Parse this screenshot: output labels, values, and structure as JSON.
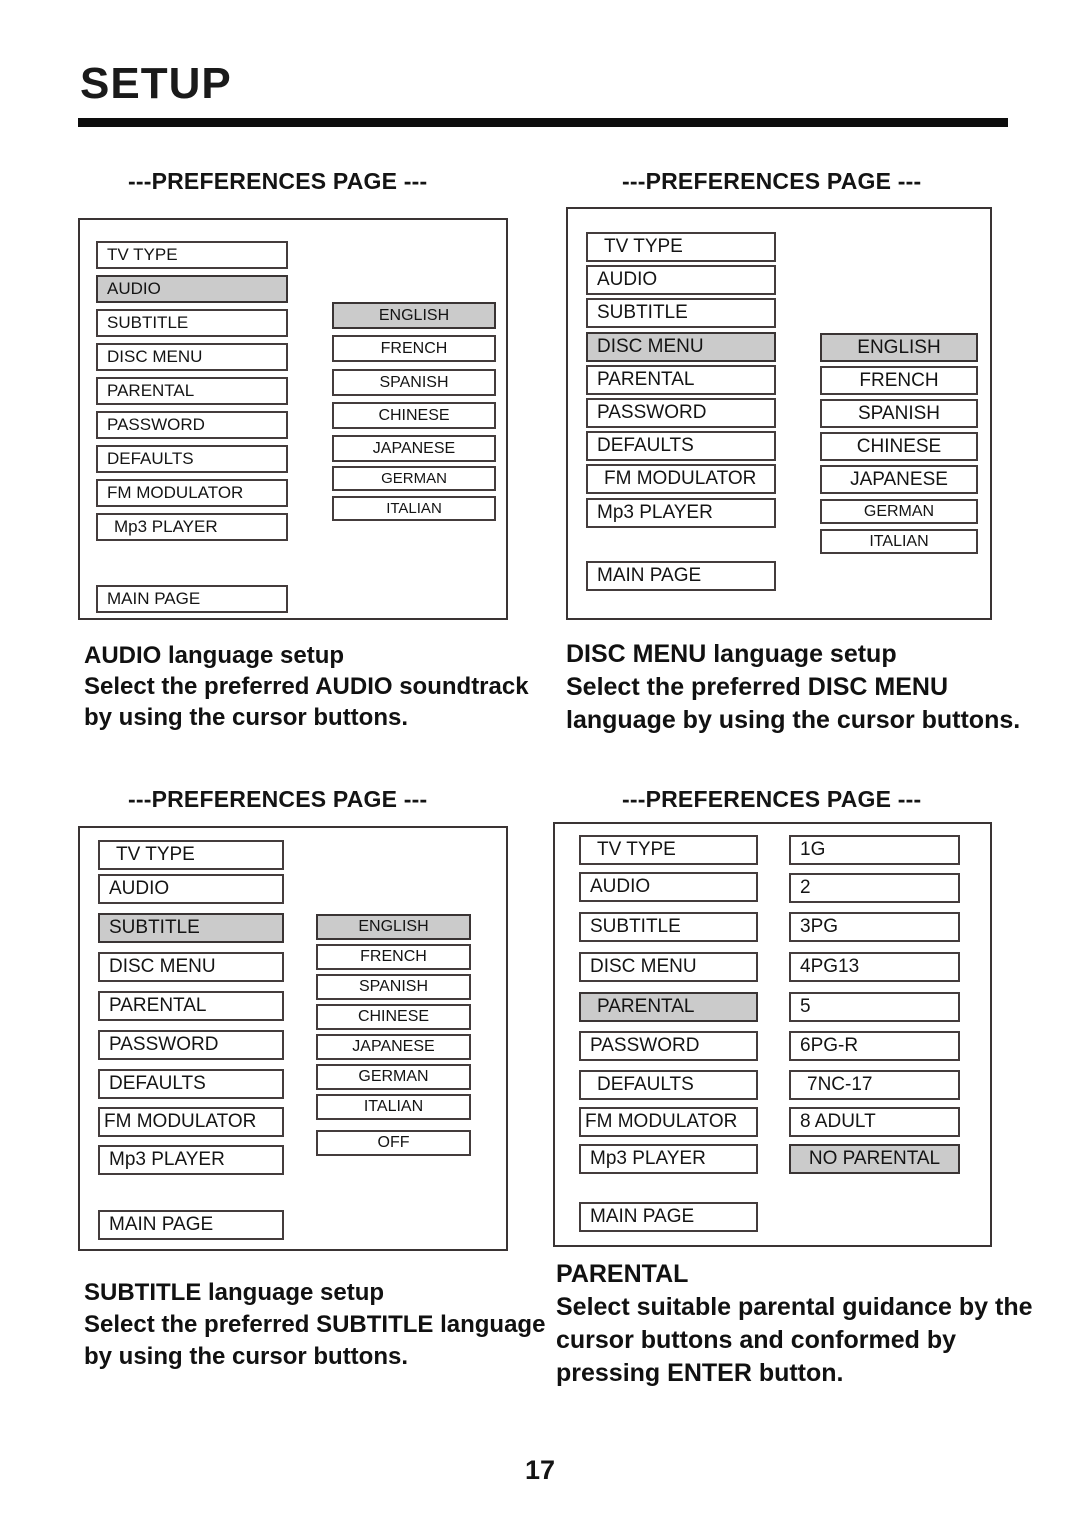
{
  "document": {
    "title": "SETUP",
    "page_number": "17"
  },
  "panels": [
    {
      "heading": "---PREFERENCES PAGE ---",
      "menu": [
        "TV  TYPE",
        "AUDIO",
        "SUBTITLE",
        "DISC MENU",
        "PARENTAL",
        "PASSWORD",
        "DEFAULTS",
        "FM MODULATOR",
        "Mp3 PLAYER"
      ],
      "menu_selected": "AUDIO",
      "footer_item": "MAIN PAGE",
      "options": [
        "ENGLISH",
        "FRENCH",
        "SPANISH",
        "CHINESE",
        "JAPANESE",
        "GERMAN",
        "ITALIAN"
      ],
      "option_selected": "ENGLISH",
      "caption": [
        "AUDIO language setup",
        "Select the preferred AUDIO soundtrack",
        "by using the cursor buttons."
      ]
    },
    {
      "heading": "---PREFERENCES PAGE ---",
      "menu": [
        "TV  TYPE",
        "AUDIO",
        "SUBTITLE",
        "DISC MENU",
        "PARENTAL",
        "PASSWORD",
        "DEFAULTS",
        "FM MODULATOR",
        "Mp3 PLAYER"
      ],
      "menu_selected": "DISC MENU",
      "footer_item": "MAIN PAGE",
      "options": [
        "ENGLISH",
        "FRENCH",
        "SPANISH",
        "CHINESE",
        "JAPANESE",
        "GERMAN",
        "ITALIAN"
      ],
      "option_selected": "ENGLISH",
      "caption": [
        "DISC MENU language setup",
        "Select the preferred DISC MENU",
        "language by using the cursor buttons."
      ]
    },
    {
      "heading": "---PREFERENCES PAGE ---",
      "menu": [
        "TV  TYPE",
        "AUDIO",
        "SUBTITLE",
        "DISC MENU",
        "PARENTAL",
        "PASSWORD",
        "DEFAULTS",
        "FM MODULATOR",
        "Mp3 PLAYER"
      ],
      "menu_selected": "SUBTITLE",
      "footer_item": "MAIN PAGE",
      "options": [
        "ENGLISH",
        "FRENCH",
        "SPANISH",
        "CHINESE",
        "JAPANESE",
        "GERMAN",
        "ITALIAN",
        "OFF"
      ],
      "option_selected": "ENGLISH",
      "caption": [
        "SUBTITLE language setup",
        "Select the preferred SUBTITLE  language",
        " by using the cursor buttons."
      ]
    },
    {
      "heading": "---PREFERENCES PAGE ---",
      "menu": [
        "TV  TYPE",
        "AUDIO",
        "SUBTITLE",
        "DISC MENU",
        "PARENTAL",
        "PASSWORD",
        "DEFAULTS",
        "FM MODULATOR",
        "Mp3 PLAYER"
      ],
      "menu_selected": "PARENTAL",
      "footer_item": "MAIN PAGE",
      "options": [
        "1G",
        "2",
        "3PG",
        "4PG13",
        "5",
        "6PG-R",
        "7NC-17",
        "8 ADULT",
        "NO PARENTAL"
      ],
      "option_selected": "NO PARENTAL",
      "caption": [
        "PARENTAL",
        "Select suitable parental guidance by the",
        "cursor buttons and conformed by",
        "pressing ENTER button."
      ]
    }
  ],
  "colors": {
    "selection_gray": "#cbcbcb",
    "border": "#443c3c",
    "text": "#141414",
    "rule": "#0d0d0d"
  }
}
